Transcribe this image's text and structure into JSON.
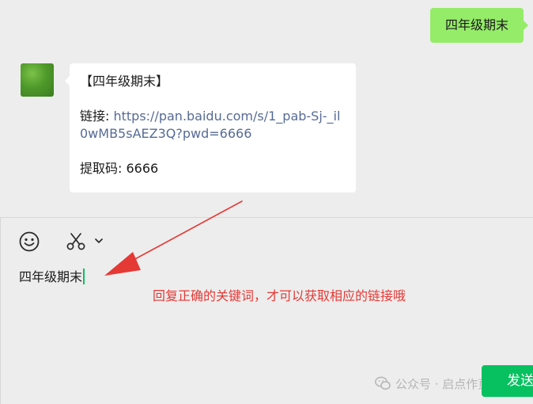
{
  "chat": {
    "outgoing_message": "四年级期末",
    "incoming_message": {
      "title": "【四年级期末】",
      "link_prefix": "链接: ",
      "link_url": "https://pan.baidu.com/s/1_pab-Sj-_il0wMB5sAEZ3Q?pwd=6666",
      "code_label": "提取码: 6666"
    }
  },
  "toolbar": {
    "emoji_icon": "smiley-face-icon",
    "screenshot_icon": "scissors-icon",
    "dropdown_icon": "chevron-down-icon"
  },
  "composer": {
    "input_value": "四年级期末",
    "send_label": "发送"
  },
  "annotation": {
    "text": "回复正确的关键词，才可以获取相应的链接哦",
    "color": "#e53935"
  },
  "watermark": {
    "text": "公众号 · 启点作页"
  },
  "colors": {
    "outgoing_bubble": "#95ec69",
    "incoming_bubble": "#ffffff",
    "link": "#576b95",
    "send_button": "#07c160",
    "background": "#ededed"
  }
}
